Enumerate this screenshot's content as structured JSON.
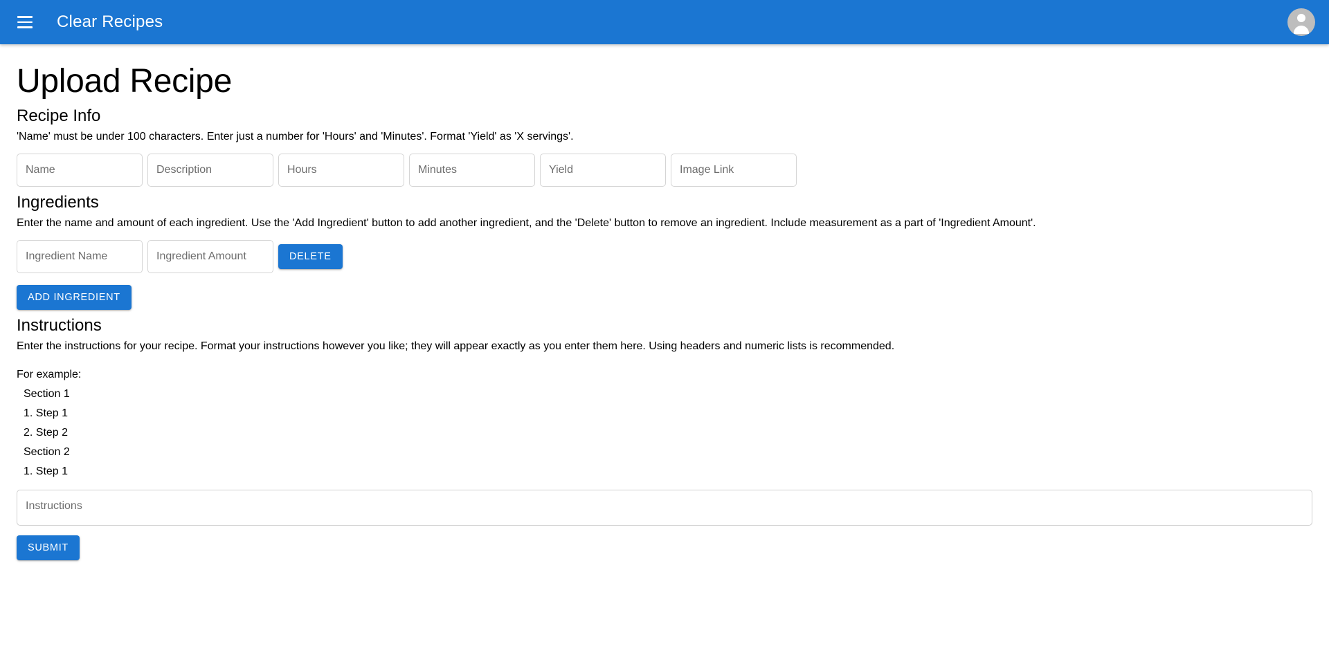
{
  "appbar": {
    "menu_icon": "hamburger-menu-icon",
    "title": "Clear Recipes",
    "avatar_icon": "account-circle-icon",
    "background_color": "#1b76d2"
  },
  "page": {
    "title": "Upload Recipe"
  },
  "recipe_info": {
    "heading": "Recipe Info",
    "description": "'Name' must be under 100 characters. Enter just a number for 'Hours' and 'Minutes'. Format 'Yield' as 'X servings'.",
    "fields": [
      {
        "name": "name",
        "placeholder": "Name",
        "value": ""
      },
      {
        "name": "description",
        "placeholder": "Description",
        "value": ""
      },
      {
        "name": "hours",
        "placeholder": "Hours",
        "value": ""
      },
      {
        "name": "minutes",
        "placeholder": "Minutes",
        "value": ""
      },
      {
        "name": "yield",
        "placeholder": "Yield",
        "value": ""
      },
      {
        "name": "image_link",
        "placeholder": "Image Link",
        "value": ""
      }
    ]
  },
  "ingredients": {
    "heading": "Ingredients",
    "description": "Enter the name and amount of each ingredient. Use the 'Add Ingredient' button to add another ingredient, and the 'Delete' button to remove an ingredient. Include measurement as a part of 'Ingredient Amount'.",
    "rows": [
      {
        "name_placeholder": "Ingredient Name",
        "name_value": "",
        "amount_placeholder": "Ingredient Amount",
        "amount_value": "",
        "delete_label": "DELETE"
      }
    ],
    "add_label": "ADD INGREDIENT"
  },
  "instructions": {
    "heading": "Instructions",
    "description": "Enter the instructions for your recipe. Format your instructions however you like; they will appear exactly as you enter them here. Using headers and numeric lists is recommended.",
    "example_label": "For example:",
    "example_lines": [
      "Section 1",
      "1. Step 1",
      "2. Step 2",
      "Section 2",
      "1. Step 1"
    ],
    "placeholder": "Instructions",
    "value": ""
  },
  "submit": {
    "label": "SUBMIT"
  }
}
